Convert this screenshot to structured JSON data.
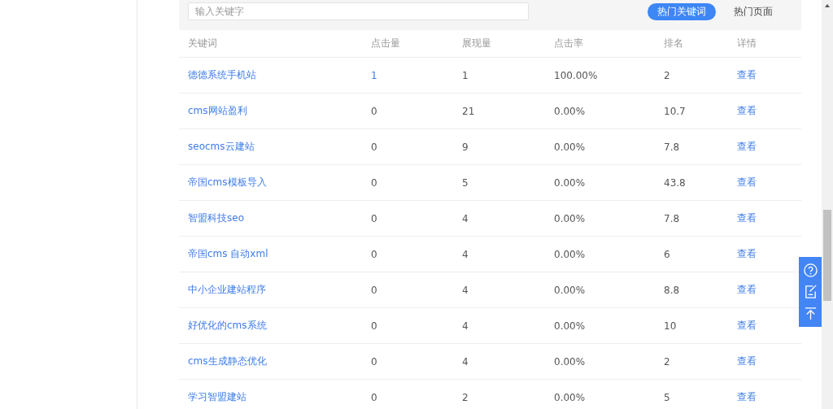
{
  "search": {
    "placeholder": "输入关键字"
  },
  "tabs": [
    {
      "label": "热门关键词",
      "selected": true
    },
    {
      "label": "热门页面",
      "selected": false
    }
  ],
  "table": {
    "columns": [
      "关键词",
      "点击量",
      "展现量",
      "点击率",
      "排名",
      "详情"
    ],
    "rows": [
      {
        "keyword": "德德系统手机站",
        "clicks": "1",
        "clicks_link": true,
        "impressions": "1",
        "ctr": "100.00%",
        "rank": "2",
        "detail": "查看"
      },
      {
        "keyword": "cms网站盈利",
        "clicks": "0",
        "clicks_link": false,
        "impressions": "21",
        "ctr": "0.00%",
        "rank": "10.7",
        "detail": "查看"
      },
      {
        "keyword": "seocms云建站",
        "clicks": "0",
        "clicks_link": false,
        "impressions": "9",
        "ctr": "0.00%",
        "rank": "7.8",
        "detail": "查看"
      },
      {
        "keyword": "帝国cms模板导入",
        "clicks": "0",
        "clicks_link": false,
        "impressions": "5",
        "ctr": "0.00%",
        "rank": "43.8",
        "detail": "查看"
      },
      {
        "keyword": "智盟科技seo",
        "clicks": "0",
        "clicks_link": false,
        "impressions": "4",
        "ctr": "0.00%",
        "rank": "7.8",
        "detail": "查看"
      },
      {
        "keyword": "帝国cms 自动xml",
        "clicks": "0",
        "clicks_link": false,
        "impressions": "4",
        "ctr": "0.00%",
        "rank": "6",
        "detail": "查看"
      },
      {
        "keyword": "中小企业建站程序",
        "clicks": "0",
        "clicks_link": false,
        "impressions": "4",
        "ctr": "0.00%",
        "rank": "8.8",
        "detail": "查看"
      },
      {
        "keyword": "好优化的cms系统",
        "clicks": "0",
        "clicks_link": false,
        "impressions": "4",
        "ctr": "0.00%",
        "rank": "10",
        "detail": "查看"
      },
      {
        "keyword": "cms生成静态优化",
        "clicks": "0",
        "clicks_link": false,
        "impressions": "4",
        "ctr": "0.00%",
        "rank": "2",
        "detail": "查看"
      },
      {
        "keyword": "学习智盟建站",
        "clicks": "0",
        "clicks_link": false,
        "impressions": "2",
        "ctr": "0.00%",
        "rank": "5",
        "detail": "查看"
      }
    ]
  }
}
